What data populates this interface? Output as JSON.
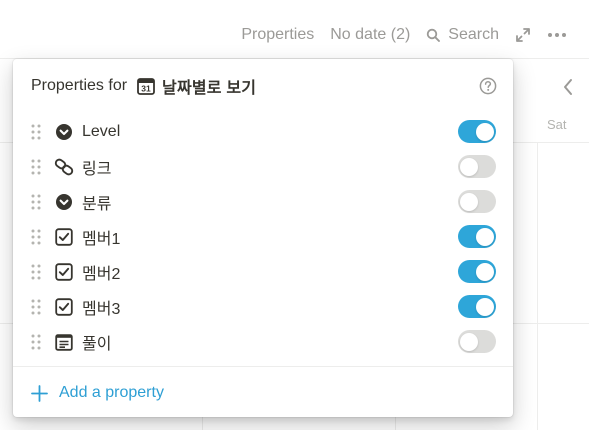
{
  "toolbar": {
    "properties_label": "Properties",
    "no_date_label": "No date (2)",
    "search_label": "Search",
    "expand_icon": "expand-diagonal-icon",
    "more_icon": "more-horizontal-icon"
  },
  "calendar": {
    "day_label": "Sat",
    "nav_icon": "chevron-left-icon"
  },
  "popup": {
    "title_prefix": "Properties for",
    "view_icon": "calendar-icon",
    "view_icon_text": "31",
    "view_name": "날짜별로 보기",
    "help_icon": "question-circle-icon",
    "properties": [
      {
        "name": "Level",
        "type_icon": "select-icon",
        "visible": true
      },
      {
        "name": "링크",
        "type_icon": "relation-link-icon",
        "visible": false
      },
      {
        "name": "분류",
        "type_icon": "select-icon",
        "visible": false
      },
      {
        "name": "멤버1",
        "type_icon": "checkbox-icon",
        "visible": true
      },
      {
        "name": "멤버2",
        "type_icon": "checkbox-icon",
        "visible": true
      },
      {
        "name": "멤버3",
        "type_icon": "checkbox-icon",
        "visible": true
      },
      {
        "name": "풀이",
        "type_icon": "text-icon",
        "visible": false
      }
    ],
    "add_label": "Add a property"
  },
  "colors": {
    "accent": "#2ea6d9",
    "toggle_off": "#dcdcda",
    "link_blue": "#2e9fd4",
    "muted_text": "#9b9a97"
  }
}
